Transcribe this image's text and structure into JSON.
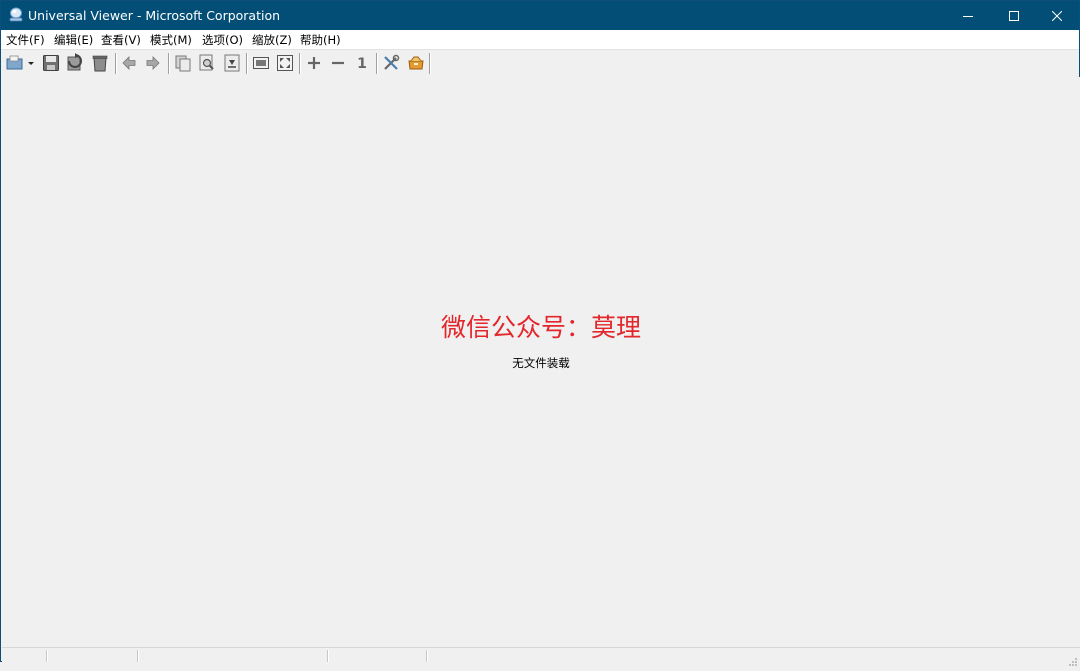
{
  "window": {
    "title": "Universal Viewer - Microsoft Corporation",
    "title_bar_color": "#034e77"
  },
  "menu": {
    "items": [
      "文件(F)",
      "编辑(E)",
      "查看(V)",
      "模式(M)",
      "选项(O)",
      "缩放(Z)",
      "帮助(H)"
    ]
  },
  "toolbar": {
    "buttons": [
      "open-icon",
      "dropdown-arrow-icon",
      "save-icon",
      "reload-icon",
      "delete-icon",
      "back-icon",
      "forward-icon",
      "copy-icon",
      "find-icon",
      "next-page-icon",
      "fit-window-icon",
      "fullscreen-icon",
      "zoom-in-icon",
      "zoom-out-icon",
      "original-size-icon",
      "settings-icon",
      "plugins-icon"
    ],
    "zoom_original_label": "1"
  },
  "content": {
    "watermark": "微信公众号：莫理",
    "watermark_color": "#e3262b",
    "empty_message": "无文件装载"
  }
}
